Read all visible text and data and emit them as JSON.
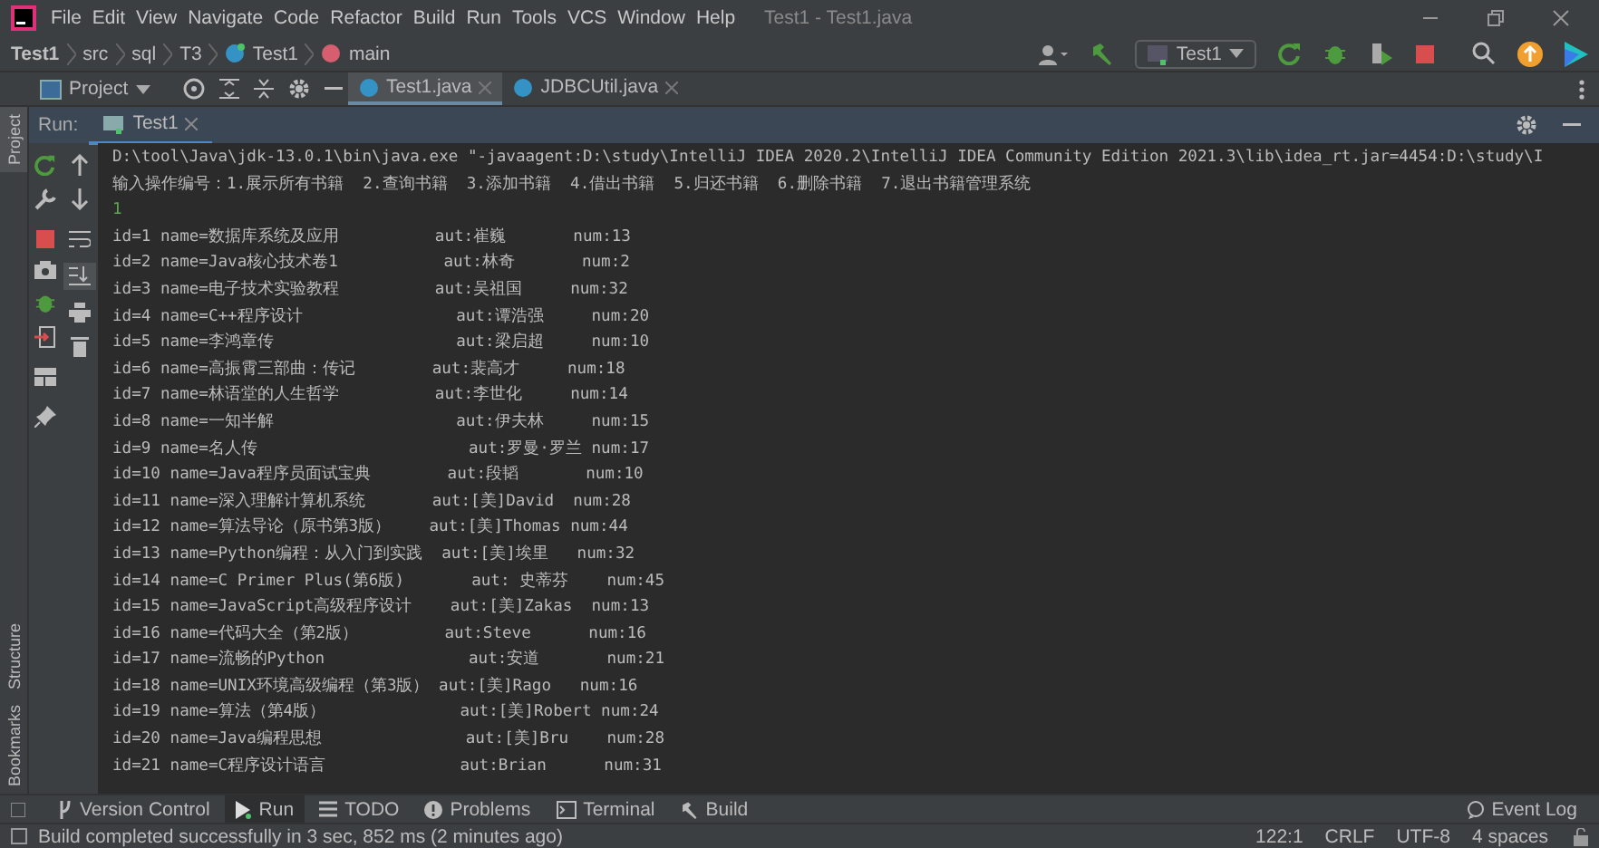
{
  "window": {
    "title": "Test1 - Test1.java"
  },
  "menu_bar": [
    "File",
    "Edit",
    "View",
    "Navigate",
    "Code",
    "Refactor",
    "Build",
    "Run",
    "Tools",
    "VCS",
    "Window",
    "Help"
  ],
  "breadcrumbs": [
    {
      "label": "Test1",
      "kind": "project"
    },
    {
      "label": "src",
      "kind": "folder"
    },
    {
      "label": "sql",
      "kind": "folder"
    },
    {
      "label": "T3",
      "kind": "folder"
    },
    {
      "label": "Test1",
      "kind": "class"
    },
    {
      "label": "main",
      "kind": "method"
    }
  ],
  "run_config": {
    "label": "Test1"
  },
  "project_panel": {
    "label": "Project"
  },
  "editor_tabs": [
    {
      "label": "Test1.java",
      "selected": true
    },
    {
      "label": "JDBCUtil.java",
      "selected": false
    }
  ],
  "run_panel": {
    "label": "Run:",
    "tab": "Test1"
  },
  "console": [
    {
      "kind": "command",
      "text": "D:\\tool\\Java\\jdk-13.0.1\\bin\\java.exe \"-javaagent:D:\\study\\IntelliJ IDEA 2020.2\\IntelliJ IDEA Community Edition 2021.3\\lib\\idea_rt.jar=4454:D:\\study\\I"
    },
    {
      "kind": "output",
      "text": "输入操作编号：1.展示所有书籍  2.查询书籍  3.添加书籍  4.借出书籍  5.归还书籍  6.删除书籍  7.退出书籍管理系统"
    },
    {
      "kind": "input",
      "text": "1"
    },
    {
      "kind": "output",
      "text": "id=1 name=数据库系统及应用          aut:崔巍       num:13"
    },
    {
      "kind": "output",
      "text": "id=2 name=Java核心技术卷1           aut:林奇       num:2"
    },
    {
      "kind": "output",
      "text": "id=3 name=电子技术实验教程          aut:吴祖国     num:32"
    },
    {
      "kind": "output",
      "text": "id=4 name=C++程序设计                aut:谭浩强     num:20"
    },
    {
      "kind": "output",
      "text": "id=5 name=李鸿章传                   aut:梁启超     num:10"
    },
    {
      "kind": "output",
      "text": "id=6 name=高振霄三部曲：传记        aut:裴高才     num:18"
    },
    {
      "kind": "output",
      "text": "id=7 name=林语堂的人生哲学          aut:李世化     num:14"
    },
    {
      "kind": "output",
      "text": "id=8 name=一知半解                   aut:伊夫林     num:15"
    },
    {
      "kind": "output",
      "text": "id=9 name=名人传                      aut:罗曼·罗兰 num:17"
    },
    {
      "kind": "output",
      "text": "id=10 name=Java程序员面试宝典        aut:段韬       num:10"
    },
    {
      "kind": "output",
      "text": "id=11 name=深入理解计算机系统       aut:[美]David  num:28"
    },
    {
      "kind": "output",
      "text": "id=12 name=算法导论（原书第3版）    aut:[美]Thomas num:44"
    },
    {
      "kind": "output",
      "text": "id=13 name=Python编程：从入门到实践  aut:[美]埃里   num:32"
    },
    {
      "kind": "output",
      "text": "id=14 name=C Primer Plus(第6版)       aut: 史蒂芬    num:45"
    },
    {
      "kind": "output",
      "text": "id=15 name=JavaScript高级程序设计    aut:[美]Zakas  num:13"
    },
    {
      "kind": "output",
      "text": "id=16 name=代码大全（第2版）         aut:Steve      num:16"
    },
    {
      "kind": "output",
      "text": "id=17 name=流畅的Python               aut:安道       num:21"
    },
    {
      "kind": "output",
      "text": "id=18 name=UNIX环境高级编程（第3版） aut:[美]Rago   num:16"
    },
    {
      "kind": "output",
      "text": "id=19 name=算法（第4版）              aut:[美]Robert num:24"
    },
    {
      "kind": "output",
      "text": "id=20 name=Java编程思想               aut:[美]Bru    num:28"
    },
    {
      "kind": "output",
      "text": "id=21 name=C程序设计语言              aut:Brian      num:31"
    }
  ],
  "left_stripe": [
    {
      "label": "Project",
      "kind": "project"
    },
    {
      "label": "Structure",
      "kind": "structure"
    },
    {
      "label": "Bookmarks",
      "kind": "bookmarks"
    }
  ],
  "bottom_tabs": [
    {
      "label": "Version Control",
      "selected": false,
      "kind": "vcs"
    },
    {
      "label": "Run",
      "selected": true,
      "kind": "run"
    },
    {
      "label": "TODO",
      "selected": false,
      "kind": "todo"
    },
    {
      "label": "Problems",
      "selected": false,
      "kind": "problems"
    },
    {
      "label": "Terminal",
      "selected": false,
      "kind": "terminal"
    },
    {
      "label": "Build",
      "selected": false,
      "kind": "build"
    }
  ],
  "event_log": {
    "label": "Event Log"
  },
  "status_bar": {
    "message": "Build completed successfully in 3 sec, 852 ms (2 minutes ago)",
    "position": "122:1",
    "line_ending": "CRLF",
    "encoding": "UTF-8",
    "indent": "4 spaces"
  }
}
